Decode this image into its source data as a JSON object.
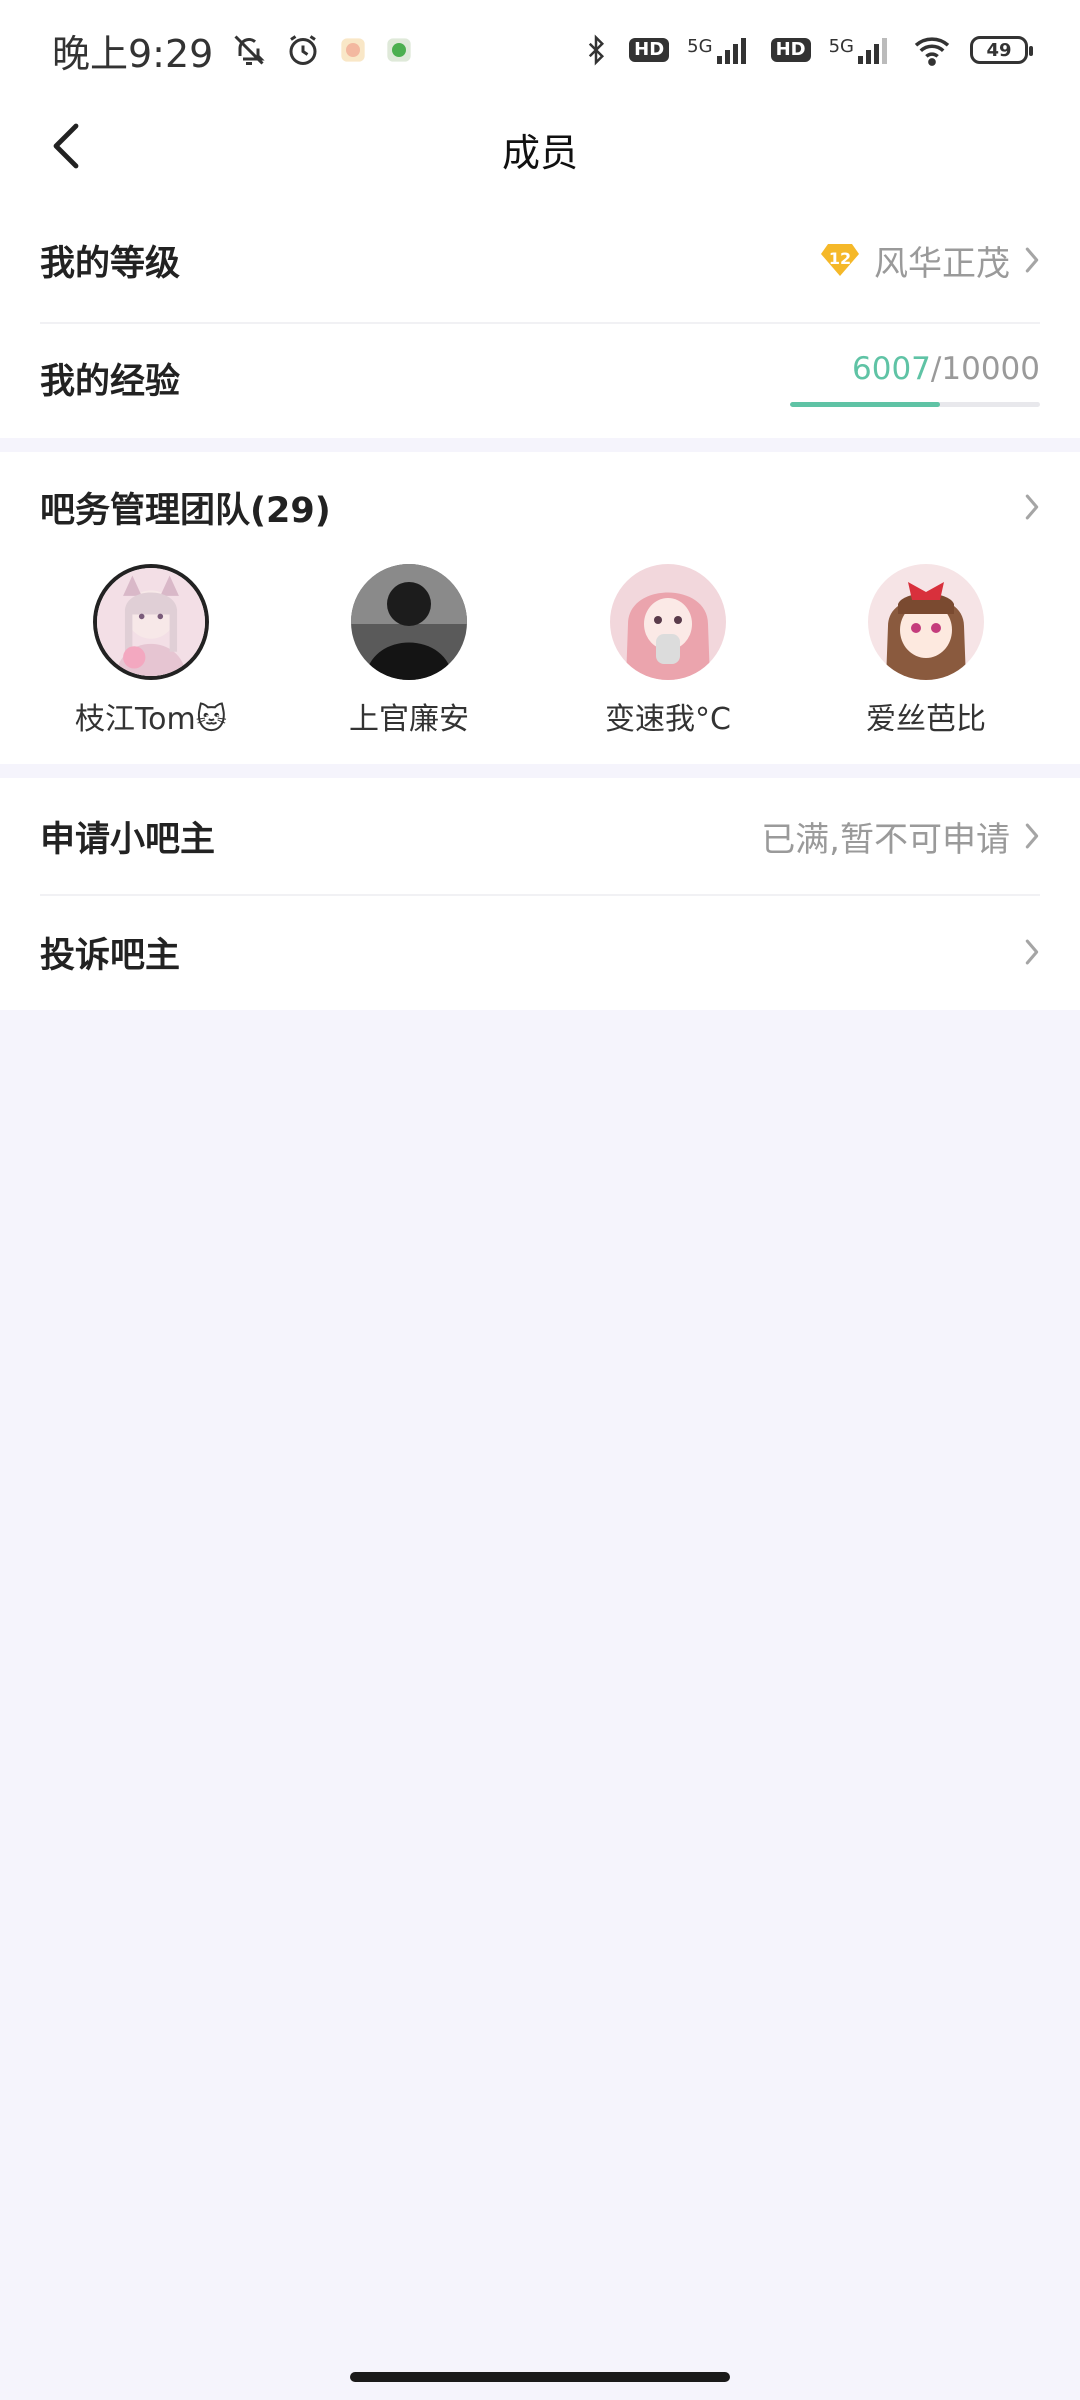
{
  "status_bar": {
    "time": "晚上9:29",
    "hd_label": "HD",
    "net1": "5G",
    "net2": "5G",
    "battery": "49"
  },
  "header": {
    "title": "成员"
  },
  "level_row": {
    "label": "我的等级",
    "badge_number": "12",
    "level_name": "风华正茂"
  },
  "exp_row": {
    "label": "我的经验",
    "current": "6007",
    "separator": "/",
    "total": "10000",
    "progress_fraction": 0.6
  },
  "team": {
    "title": "吧务管理团队(29)",
    "members": [
      {
        "name": "枝江Tom🐱"
      },
      {
        "name": "上官廉安"
      },
      {
        "name": "变速我°C"
      },
      {
        "name": "爱丝芭比"
      }
    ]
  },
  "apply_row": {
    "label": "申请小吧主",
    "status": "已满,暂不可申请"
  },
  "complain_row": {
    "label": "投诉吧主"
  },
  "colors": {
    "accent_green": "#5fc3a5",
    "badge_gold": "#f5b829",
    "page_bg": "#f5f4fc"
  }
}
